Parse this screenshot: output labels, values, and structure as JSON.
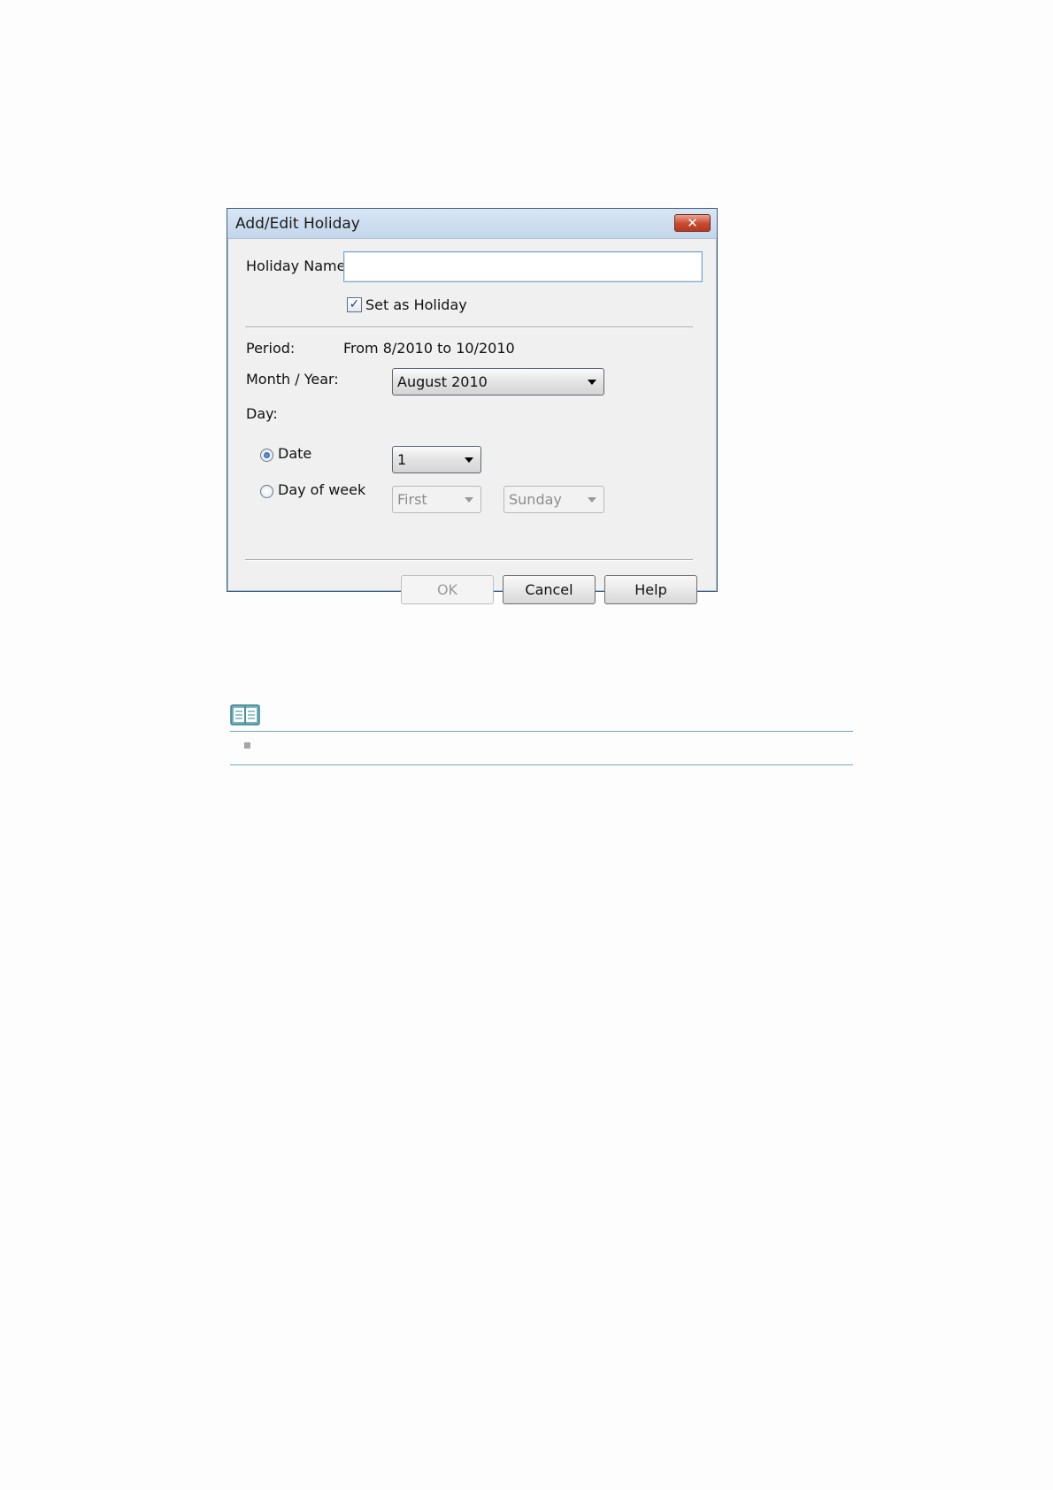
{
  "dialog": {
    "title": "Add/Edit Holiday",
    "close_glyph": "✕",
    "holiday_name_label": "Holiday Name:",
    "holiday_name_value": "",
    "set_as_holiday_label": "Set as Holiday",
    "set_as_holiday_checked": true,
    "period_label": "Period:",
    "period_value": "From 8/2010 to 10/2010",
    "month_year_label": "Month / Year:",
    "month_year_value": "August 2010",
    "day_label": "Day:",
    "date_option_label": "Date",
    "date_selected": true,
    "date_value": "1",
    "day_of_week_option_label": "Day of week",
    "week_ordinal_value": "First",
    "weekday_value": "Sunday",
    "buttons": {
      "ok": "OK",
      "cancel": "Cancel",
      "help": "Help"
    }
  },
  "note": {
    "icon": "book-icon",
    "accent_color": "#6fa8b4",
    "items": [
      ""
    ]
  }
}
